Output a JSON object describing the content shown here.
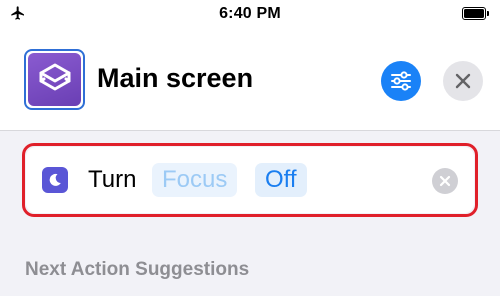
{
  "status_bar": {
    "time": "6:40 PM",
    "airplane_icon": "airplane-icon",
    "battery_icon": "battery-icon"
  },
  "header": {
    "title": "Main screen",
    "app_icon": "shortcuts-icon",
    "settings_icon": "sliders-icon",
    "close_icon": "close-icon"
  },
  "action": {
    "icon": "moon-icon",
    "verb": "Turn",
    "params": [
      "Focus",
      "Off"
    ],
    "remove_icon": "remove-icon"
  },
  "suggestions": {
    "header": "Next Action Suggestions"
  },
  "colors": {
    "accent": "#1a82f7",
    "highlight": "#e0202a",
    "app_icon": "#7a4cc4",
    "focus_icon": "#5a56d6"
  }
}
